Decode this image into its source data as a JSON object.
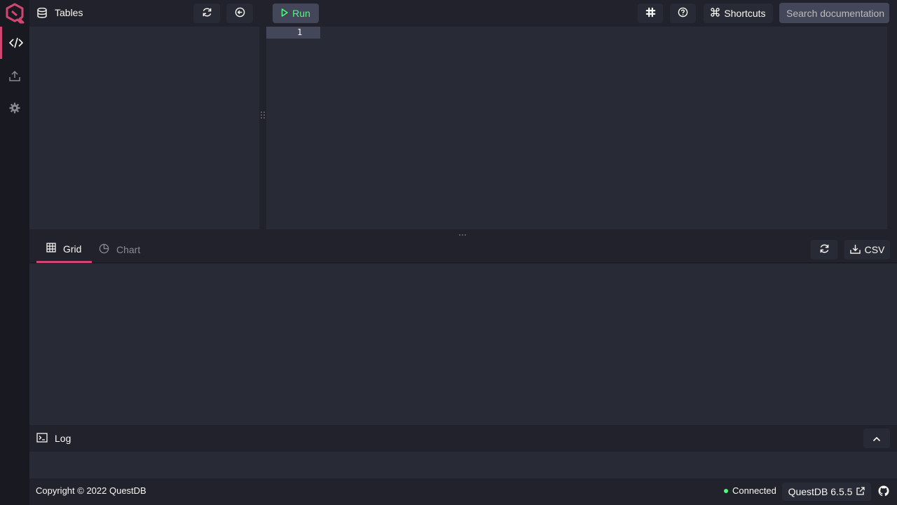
{
  "colors": {
    "accent": "#d14671",
    "run_green": "#50fa7b",
    "background": "#21222c",
    "panel": "#282a36",
    "rail": "#191a21"
  },
  "rail": {
    "items": [
      {
        "icon": "code-icon",
        "active": true
      },
      {
        "icon": "upload-icon",
        "active": false
      },
      {
        "icon": "gear-icon",
        "active": false
      }
    ]
  },
  "tables": {
    "title": "Tables",
    "icon": "database-icon"
  },
  "editor": {
    "run_label": "Run",
    "line_numbers": [
      "1"
    ]
  },
  "header": {
    "shortcuts_label": "Shortcuts",
    "search_placeholder": "Search documentation"
  },
  "results": {
    "tabs": [
      {
        "label": "Grid",
        "icon": "grid-icon",
        "active": true
      },
      {
        "label": "Chart",
        "icon": "pie-chart-icon",
        "active": false
      }
    ],
    "csv_label": "CSV"
  },
  "log": {
    "title": "Log"
  },
  "footer": {
    "copyright": "Copyright © 2022 QuestDB",
    "status": "Connected",
    "version": "QuestDB 6.5.5"
  }
}
